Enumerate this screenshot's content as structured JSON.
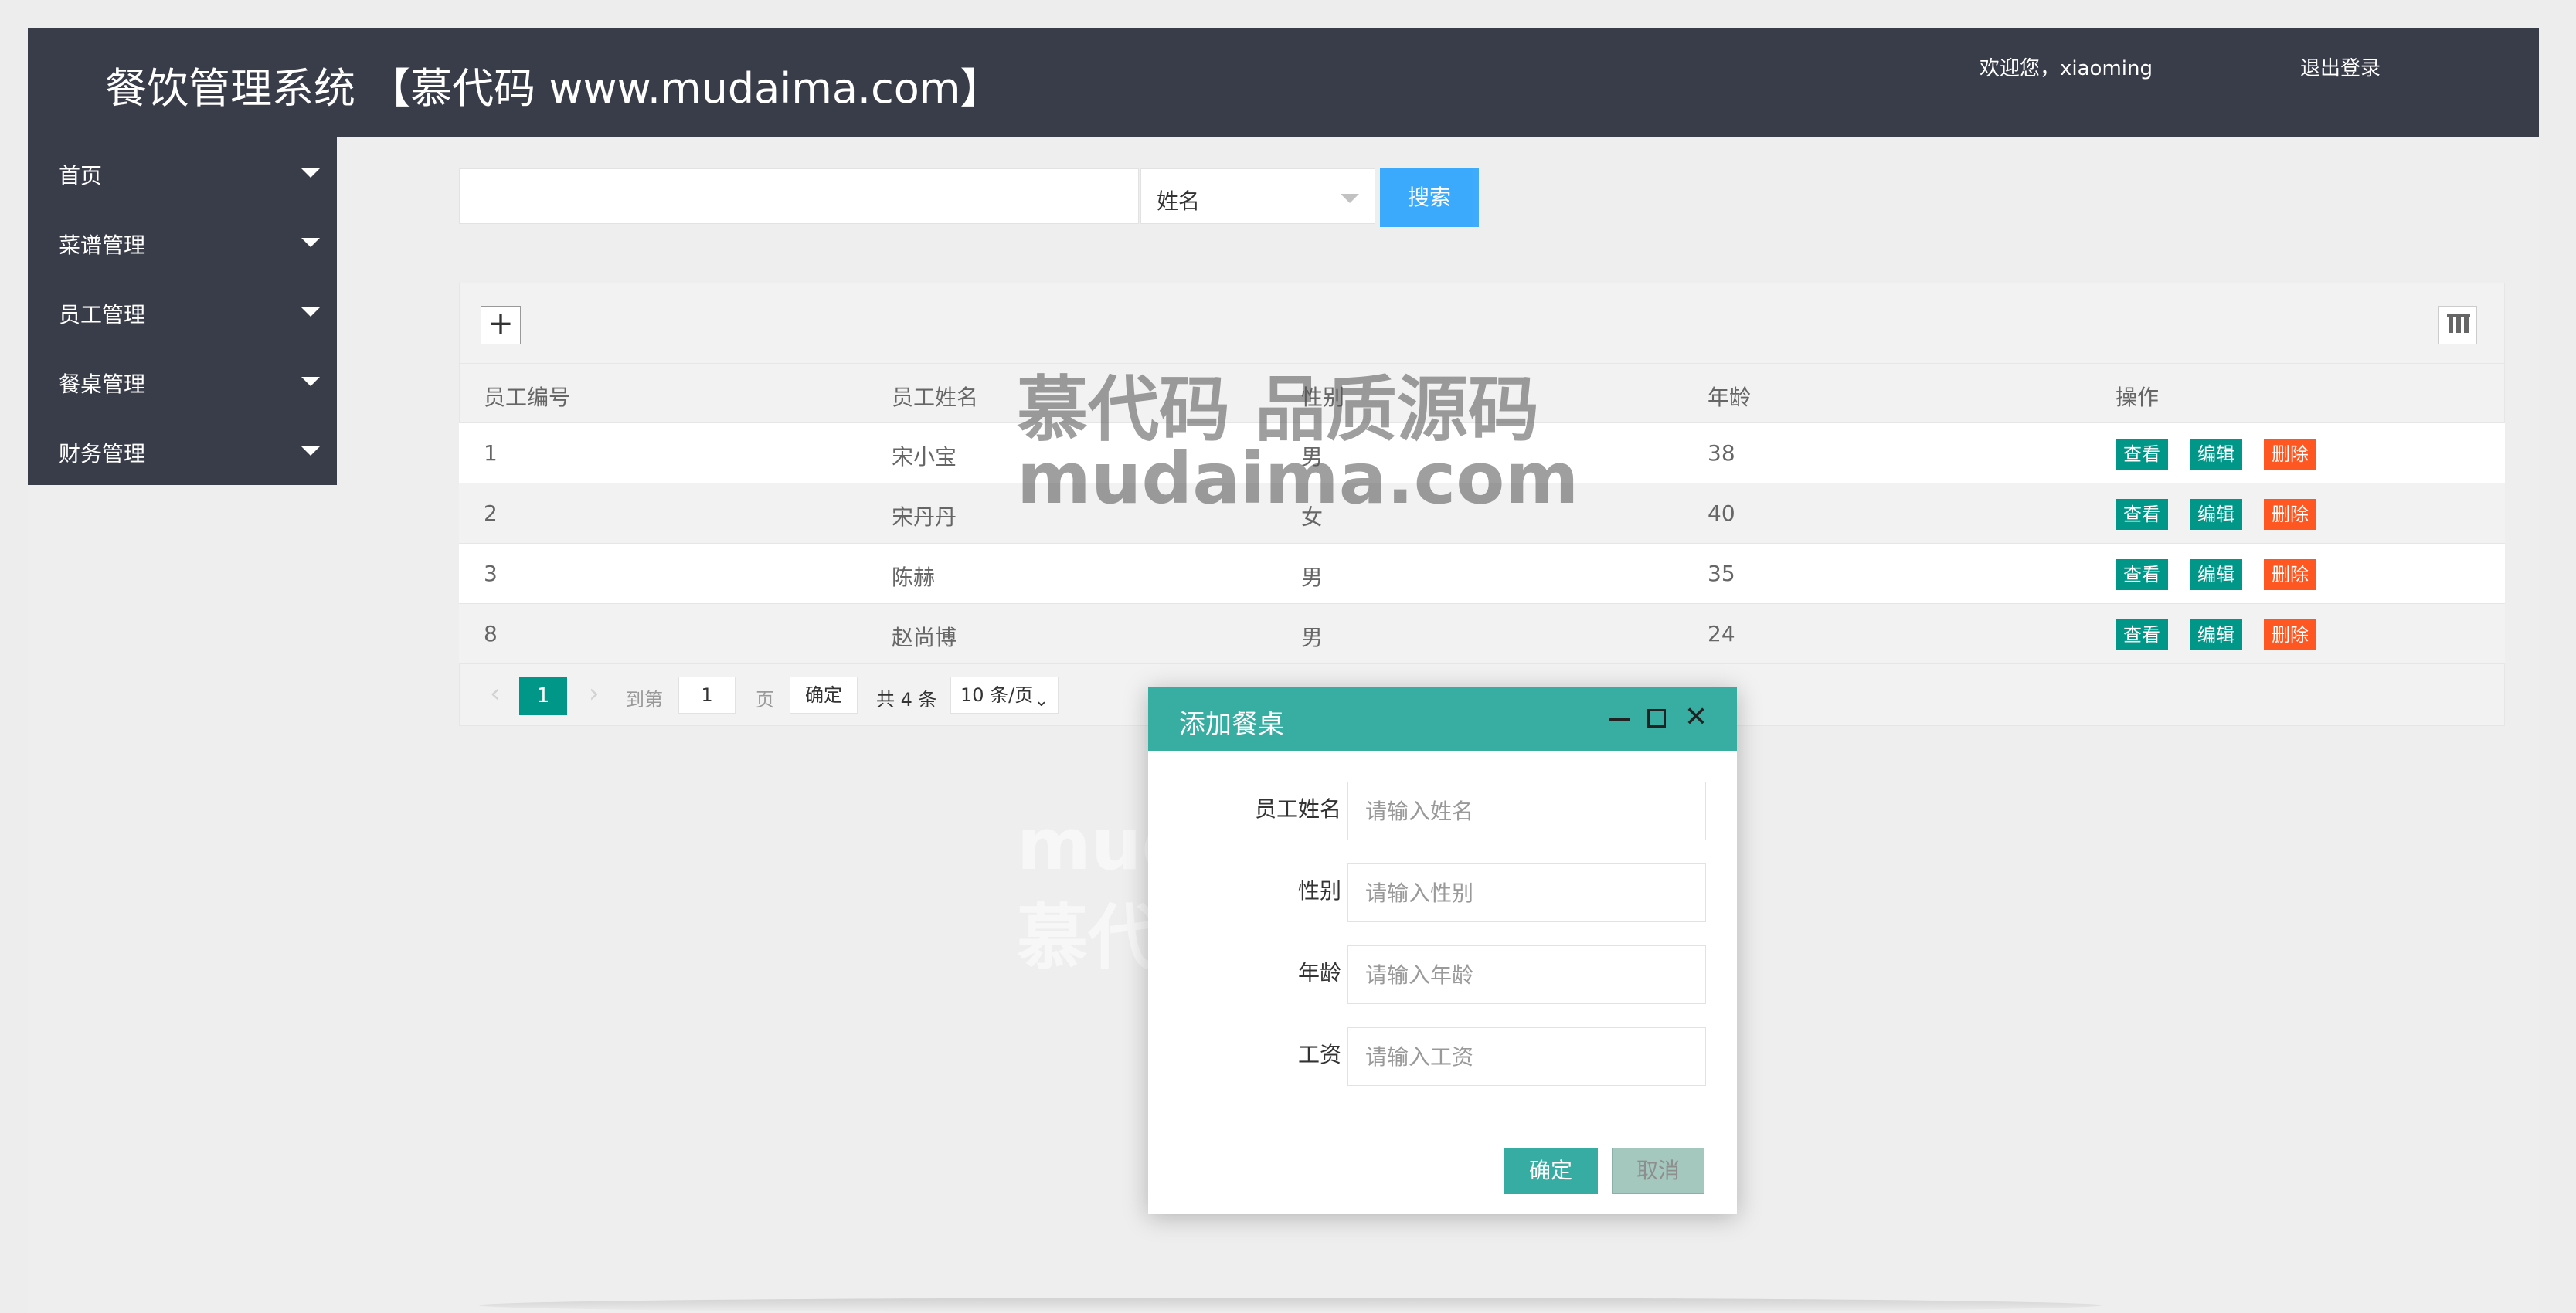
{
  "header": {
    "title": "餐饮管理系统 【慕代码 www.mudaima.com】",
    "welcome": "欢迎您，xiaoming",
    "logout": "退出登录"
  },
  "sidebar": {
    "items": [
      {
        "label": "首页"
      },
      {
        "label": "菜谱管理"
      },
      {
        "label": "员工管理"
      },
      {
        "label": "餐桌管理"
      },
      {
        "label": "财务管理"
      }
    ]
  },
  "search": {
    "value": "",
    "select_value": "姓名",
    "button": "搜索"
  },
  "toolbar": {
    "add": "+"
  },
  "table": {
    "headers": [
      "员工编号",
      "员工姓名",
      "性别",
      "年龄",
      "操作"
    ],
    "rows": [
      {
        "id": "1",
        "name": "宋小宝",
        "gender": "男",
        "age": "38"
      },
      {
        "id": "2",
        "name": "宋丹丹",
        "gender": "女",
        "age": "40"
      },
      {
        "id": "3",
        "name": "陈赫",
        "gender": "男",
        "age": "35"
      },
      {
        "id": "8",
        "name": "赵尚博",
        "gender": "男",
        "age": "24"
      }
    ],
    "actions": {
      "view": "查看",
      "edit": "编辑",
      "delete": "删除"
    }
  },
  "pager": {
    "prev": "‹",
    "current": "1",
    "next": "›",
    "goto_label": "到第",
    "goto_value": "1",
    "page_label": "页",
    "confirm": "确定",
    "total": "共 4 条",
    "page_size": "10 条/页"
  },
  "watermark": {
    "line1": "慕代码 品质源码",
    "line2": "mudaima.com",
    "faint_line1": "mudaima.com",
    "faint_line2": "慕代码"
  },
  "dialog": {
    "title": "添加餐桌",
    "fields": [
      {
        "label": "员工姓名",
        "placeholder": "请输入姓名"
      },
      {
        "label": "性别",
        "placeholder": "请输入性别"
      },
      {
        "label": "年龄",
        "placeholder": "请输入年龄"
      },
      {
        "label": "工资",
        "placeholder": "请输入工资"
      }
    ],
    "confirm": "确定",
    "cancel": "取消"
  }
}
